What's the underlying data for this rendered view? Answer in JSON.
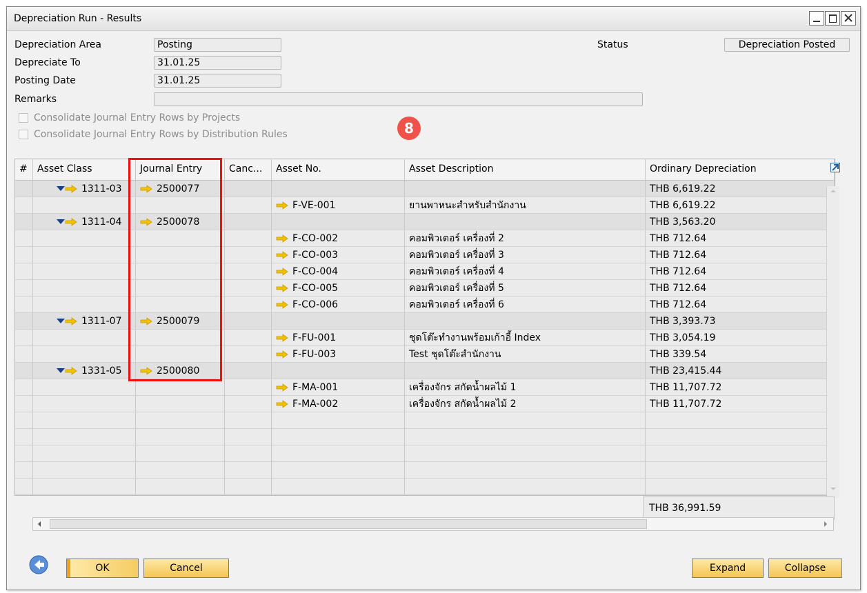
{
  "window": {
    "title": "Depreciation Run - Results"
  },
  "header": {
    "depreciation_area_label": "Depreciation Area",
    "depreciation_area_value": "Posting",
    "depreciate_to_label": "Depreciate To",
    "depreciate_to_value": "31.01.25",
    "posting_date_label": "Posting Date",
    "posting_date_value": "31.01.25",
    "remarks_label": "Remarks",
    "remarks_value": "",
    "status_label": "Status",
    "status_value": "Depreciation Posted"
  },
  "options": {
    "consolidate_projects": "Consolidate Journal Entry Rows by Projects",
    "consolidate_distribution": "Consolidate Journal Entry Rows by Distribution Rules"
  },
  "step_badge": "8",
  "grid": {
    "columns": [
      "#",
      "Asset Class",
      "Journal Entry",
      "Canc...",
      "Asset No.",
      "Asset Description",
      "Ordinary Depreciation"
    ],
    "rows": [
      {
        "type": "group",
        "asset_class": "1311-03",
        "journal_entry": "2500077",
        "asset_no": "",
        "description": "",
        "amount": "THB 6,619.22"
      },
      {
        "type": "item",
        "asset_class": "",
        "journal_entry": "",
        "asset_no": "F-VE-001",
        "description": "ยานพาหนะสำหรับสำนักงาน",
        "amount": "THB 6,619.22"
      },
      {
        "type": "group",
        "asset_class": "1311-04",
        "journal_entry": "2500078",
        "asset_no": "",
        "description": "",
        "amount": "THB 3,563.20"
      },
      {
        "type": "item",
        "asset_class": "",
        "journal_entry": "",
        "asset_no": "F-CO-002",
        "description": "คอมพิวเตอร์ เครื่องที่ 2",
        "amount": "THB 712.64"
      },
      {
        "type": "item",
        "asset_class": "",
        "journal_entry": "",
        "asset_no": "F-CO-003",
        "description": "คอมพิวเตอร์ เครื่องที่ 3",
        "amount": "THB 712.64"
      },
      {
        "type": "item",
        "asset_class": "",
        "journal_entry": "",
        "asset_no": "F-CO-004",
        "description": "คอมพิวเตอร์ เครื่องที่ 4",
        "amount": "THB 712.64"
      },
      {
        "type": "item",
        "asset_class": "",
        "journal_entry": "",
        "asset_no": "F-CO-005",
        "description": "คอมพิวเตอร์ เครื่องที่ 5",
        "amount": "THB 712.64"
      },
      {
        "type": "item",
        "asset_class": "",
        "journal_entry": "",
        "asset_no": "F-CO-006",
        "description": "คอมพิวเตอร์ เครื่องที่ 6",
        "amount": "THB 712.64"
      },
      {
        "type": "group",
        "asset_class": "1311-07",
        "journal_entry": "2500079",
        "asset_no": "",
        "description": "",
        "amount": "THB 3,393.73"
      },
      {
        "type": "item",
        "asset_class": "",
        "journal_entry": "",
        "asset_no": "F-FU-001",
        "description": "ชุดโต๊ะทำงานพร้อมเก้าอี้ Index",
        "amount": "THB 3,054.19"
      },
      {
        "type": "item",
        "asset_class": "",
        "journal_entry": "",
        "asset_no": "F-FU-003",
        "description": "Test ชุดโต๊ะสำนักงาน",
        "amount": "THB 339.54"
      },
      {
        "type": "group",
        "asset_class": "1331-05",
        "journal_entry": "2500080",
        "asset_no": "",
        "description": "",
        "amount": "THB 23,415.44"
      },
      {
        "type": "item",
        "asset_class": "",
        "journal_entry": "",
        "asset_no": "F-MA-001",
        "description": "เครื่องจักร สกัดน้ำผลไม้ 1",
        "amount": "THB 11,707.72"
      },
      {
        "type": "item",
        "asset_class": "",
        "journal_entry": "",
        "asset_no": "F-MA-002",
        "description": "เครื่องจักร สกัดน้ำผลไม้ 2",
        "amount": "THB 11,707.72"
      },
      {
        "type": "empty"
      },
      {
        "type": "empty"
      },
      {
        "type": "empty"
      },
      {
        "type": "empty"
      },
      {
        "type": "empty"
      },
      {
        "type": "empty"
      }
    ],
    "total": "THB 36,991.59"
  },
  "buttons": {
    "ok": "OK",
    "cancel": "Cancel",
    "expand": "Expand",
    "collapse": "Collapse"
  },
  "colors": {
    "arrow": "#f2c200",
    "highlight_box": "#ee1111",
    "badge": "#f0524a",
    "button": "#f4c654"
  }
}
